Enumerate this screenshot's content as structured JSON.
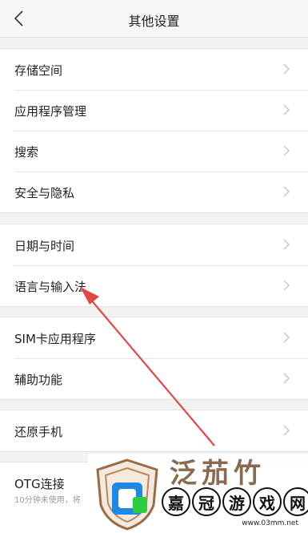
{
  "header": {
    "title": "其他设置",
    "back_icon": "chevron-left-icon"
  },
  "groups": [
    {
      "items": [
        {
          "label": "存储空间"
        },
        {
          "label": "应用程序管理"
        },
        {
          "label": "搜索"
        },
        {
          "label": "安全与隐私"
        }
      ]
    },
    {
      "items": [
        {
          "label": "日期与时间"
        },
        {
          "label": "语言与输入法"
        }
      ]
    },
    {
      "items": [
        {
          "label": "SIM卡应用程序"
        },
        {
          "label": "辅助功能"
        }
      ]
    },
    {
      "items": [
        {
          "label": "还原手机"
        }
      ]
    },
    {
      "items": [
        {
          "label": "OTG连接",
          "sub": "10分钟未使用，将"
        }
      ]
    }
  ],
  "watermark": {
    "chars": [
      "嘉",
      "冠",
      "游",
      "戏",
      "网"
    ],
    "url": "www.03mm.net",
    "top_text": "泛茄竹"
  },
  "colors": {
    "arrow": "#e04848",
    "chevron": "#c4c4c4",
    "background": "#f2f2f2"
  }
}
